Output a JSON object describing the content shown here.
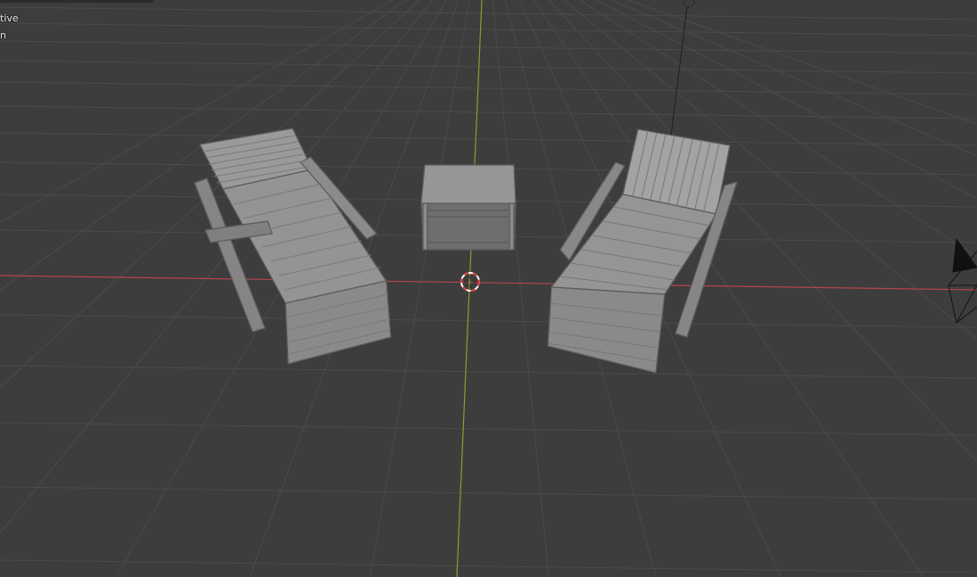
{
  "viewport": {
    "overlay_line1": "tive",
    "overlay_line2": "n"
  },
  "colors": {
    "background": "#3d3d3d",
    "grid_line": "#4a4a4a",
    "x_axis": "#b5454d",
    "y_axis": "#7fa22f",
    "furniture_fill": "#8c8c8c",
    "furniture_edge": "#5c5c5c",
    "cursor_red": "#e03a3a"
  },
  "scene_objects": [
    "lounge-chair-left",
    "side-table",
    "lounge-chair-right",
    "camera",
    "light"
  ]
}
